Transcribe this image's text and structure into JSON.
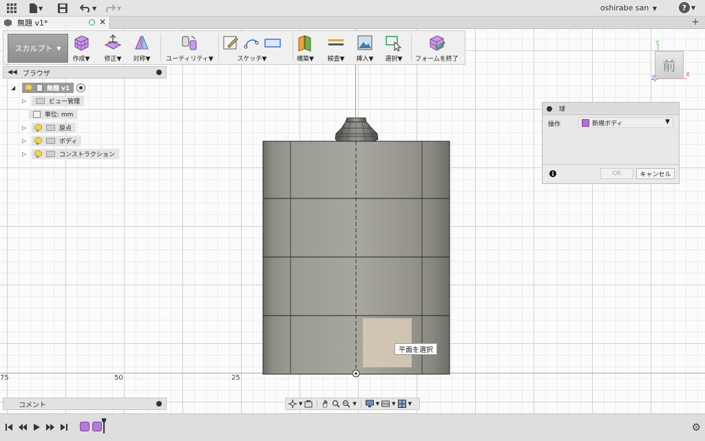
{
  "app": {
    "user": "oshirabe san",
    "help": "?"
  },
  "tabs": [
    {
      "label": "無題 v1*",
      "active": true
    }
  ],
  "toolbar": {
    "workspace": "スカルプト",
    "groups": [
      {
        "label": "作成"
      },
      {
        "label": "修正"
      },
      {
        "label": "対称"
      },
      {
        "label": "ユーティリティ"
      },
      {
        "label": "スケッチ"
      },
      {
        "label": "構築"
      },
      {
        "label": "検査"
      },
      {
        "label": "挿入"
      },
      {
        "label": "選択"
      },
      {
        "label": "フォームを終了"
      }
    ]
  },
  "browser": {
    "title": "ブラウザ",
    "root": "無題 v1",
    "items": [
      {
        "label": "ビュー管理"
      },
      {
        "label": "単位: mm"
      },
      {
        "label": "原点"
      },
      {
        "label": "ボディ"
      },
      {
        "label": "コンストラクション"
      }
    ]
  },
  "comment": {
    "label": "コメント"
  },
  "viewcube": {
    "face": "前",
    "axis_x": "X",
    "axis_y": "Y",
    "axis_z": "Z"
  },
  "ruler": {
    "labels": [
      "75",
      "50",
      "25"
    ]
  },
  "dialog": {
    "title": "球",
    "operation_label": "操作",
    "operation_value": "新規ボディ",
    "ok": "OK",
    "cancel": "キャンセル"
  },
  "tooltip": "平面を選択",
  "colors": {
    "accent_purple": "#b57bd6",
    "axis_green": "#5cc05c",
    "axis_red": "#e28a8a",
    "body_gray": "#8e8e86"
  }
}
